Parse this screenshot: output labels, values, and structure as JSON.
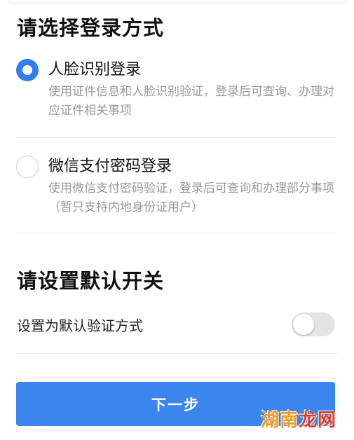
{
  "login_section": {
    "title": "请选择登录方式",
    "options": [
      {
        "title": "人脸识别登录",
        "description": "使用证件信息和人脸识别验证，登录后可查询、办理对应证件相关事项",
        "selected": true
      },
      {
        "title": "微信支付密码登录",
        "description": "使用微信支付密码验证，登录后可查询和办理部分事项（暂只支持内地身份证用户）",
        "selected": false
      }
    ]
  },
  "default_section": {
    "title": "请设置默认开关",
    "setting_label": "设置为默认验证方式",
    "toggle_on": false
  },
  "next_button": {
    "label": "下一步"
  },
  "watermark": {
    "part1": "湖南",
    "part2": "龙网"
  },
  "colors": {
    "accent": "#2f7ff2",
    "button": "#3a86ee",
    "secondary_text": "#999999"
  }
}
